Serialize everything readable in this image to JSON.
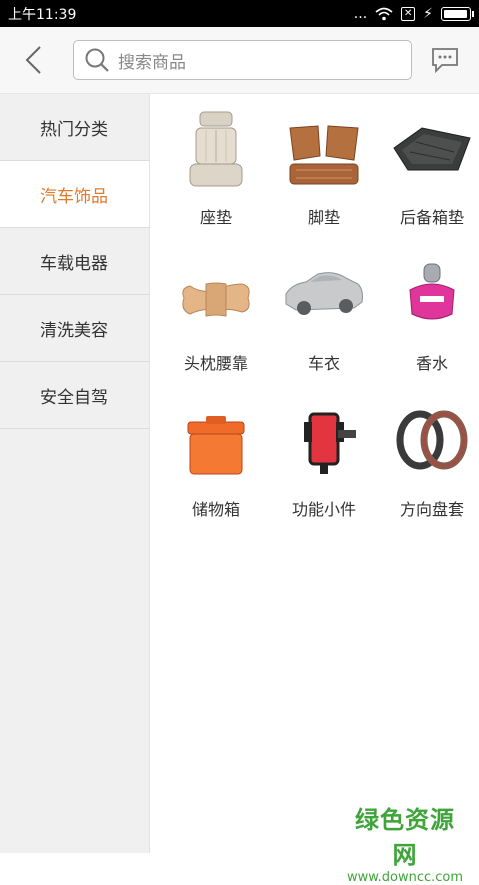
{
  "status_bar": {
    "time": "上午11:39",
    "dots": "...",
    "charging": "⚡"
  },
  "header": {
    "search_placeholder": "搜索商品"
  },
  "sidebar": {
    "items": [
      {
        "label": "热门分类",
        "active": false
      },
      {
        "label": "汽车饰品",
        "active": true
      },
      {
        "label": "车载电器",
        "active": false
      },
      {
        "label": "清洗美容",
        "active": false
      },
      {
        "label": "安全自驾",
        "active": false
      }
    ]
  },
  "products": [
    {
      "label": "座垫",
      "icon": "seat-cushion-image"
    },
    {
      "label": "脚垫",
      "icon": "floor-mat-image"
    },
    {
      "label": "后备箱垫",
      "icon": "trunk-mat-image"
    },
    {
      "label": "头枕腰靠",
      "icon": "headrest-pillow-image"
    },
    {
      "label": "车衣",
      "icon": "car-cover-image"
    },
    {
      "label": "香水",
      "icon": "perfume-image"
    },
    {
      "label": "储物箱",
      "icon": "storage-box-image"
    },
    {
      "label": "功能小件",
      "icon": "phone-holder-image"
    },
    {
      "label": "方向盘套",
      "icon": "steering-wheel-cover-image"
    }
  ],
  "watermark": {
    "title": "绿色资源网",
    "url": "www.downcc.com"
  },
  "colors": {
    "accent": "#e07a2b",
    "watermark": "#3fa53a"
  }
}
